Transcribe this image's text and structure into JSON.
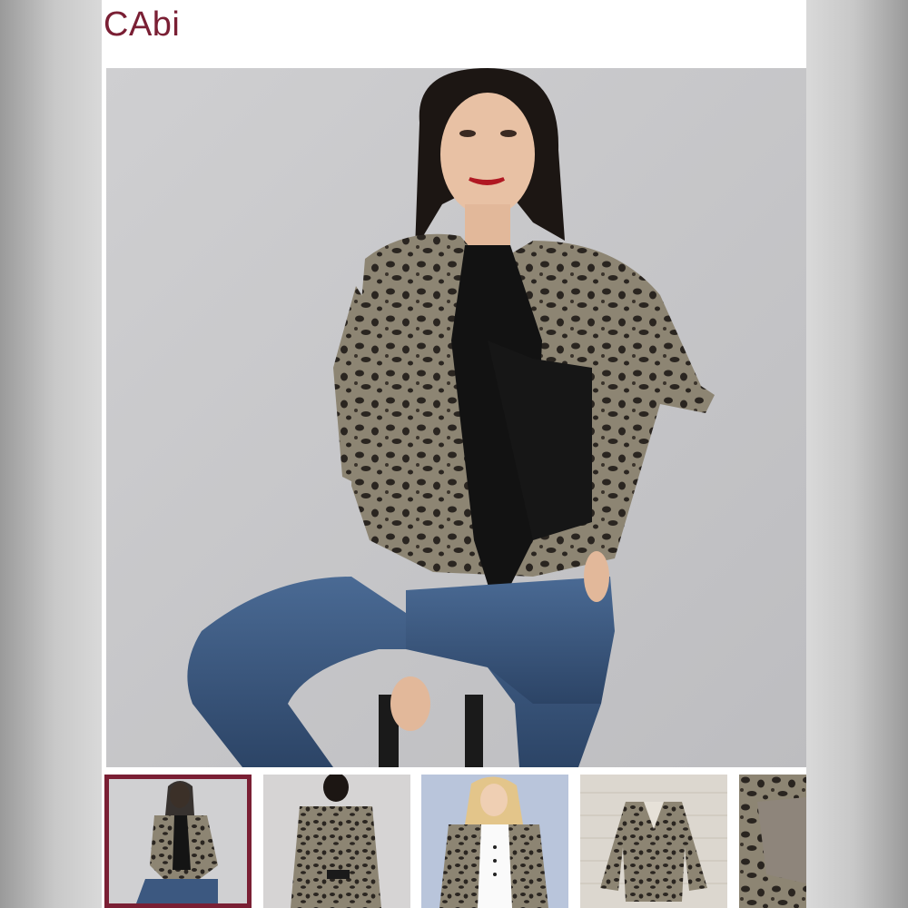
{
  "listing": {
    "brand": "CAbi",
    "accent_color": "#7a1f34"
  },
  "gallery": {
    "main_image": {
      "icon": "photo-model-leopard-blazer"
    },
    "selected_index": 0,
    "thumbnails": [
      {
        "icon": "photo-model-front"
      },
      {
        "icon": "photo-model-back"
      },
      {
        "icon": "photo-model-blonde-styled"
      },
      {
        "icon": "photo-flat-lay-blazer"
      },
      {
        "icon": "photo-fabric-closeup"
      }
    ]
  }
}
